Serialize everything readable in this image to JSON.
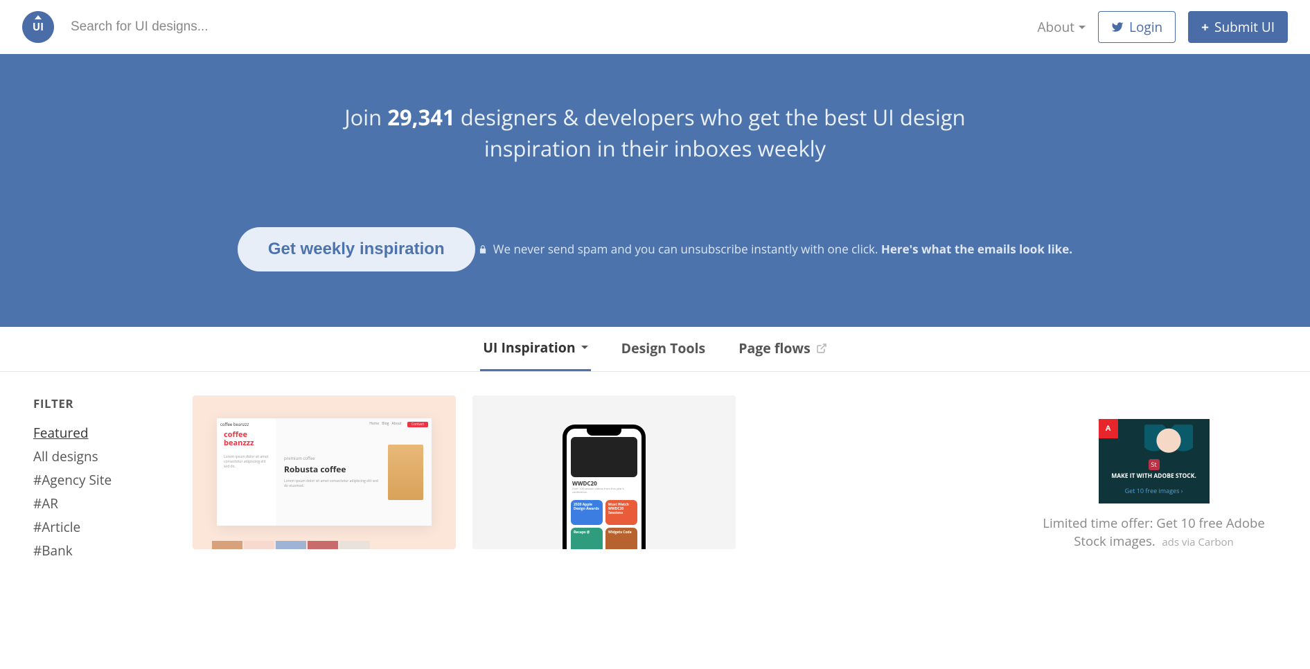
{
  "header": {
    "logo_text": "UI",
    "search_placeholder": "Search for UI designs...",
    "about_label": "About",
    "login_label": "Login",
    "submit_label": "Submit UI"
  },
  "hero": {
    "title_prefix": "Join ",
    "count": "29,341",
    "title_suffix": " designers & developers who get the best UI design inspiration in their inboxes weekly",
    "cta_label": "Get weekly inspiration",
    "note_text": "We never send spam and you can unsubscribe instantly with one click. ",
    "note_link": "Here's what the emails look like."
  },
  "tabs": {
    "inspiration": "UI Inspiration",
    "tools": "Design Tools",
    "flows": "Page flows"
  },
  "filter": {
    "title": "FILTER",
    "items": [
      "Featured",
      "All designs",
      "#Agency Site",
      "#AR",
      "#Article",
      "#Bank"
    ]
  },
  "cards": {
    "card1": {
      "brand_line1": "coffee",
      "brand_line2": "beanzzz",
      "small_label": "premium coffee",
      "product_name": "Robusta coffee",
      "header_left": "coffee beanzzz"
    },
    "card2": {
      "title": "WWDC20",
      "tiles": [
        {
          "label": "2020 Apple Design Awards",
          "color": "#3b7de0"
        },
        {
          "label": "Must Watch WWDC20 Sessions",
          "color": "#e85c3a"
        },
        {
          "label": "Recaps @",
          "color": "#2f9c7d"
        },
        {
          "label": "Widgets Code",
          "color": "#b8632f"
        }
      ]
    }
  },
  "ad": {
    "headline": "MAKE IT WITH ADOBE STOCK.",
    "subline": "Get 10 free images ›",
    "caption": "Limited time offer: Get 10 free Adobe Stock images.",
    "via": "ads via Carbon"
  }
}
